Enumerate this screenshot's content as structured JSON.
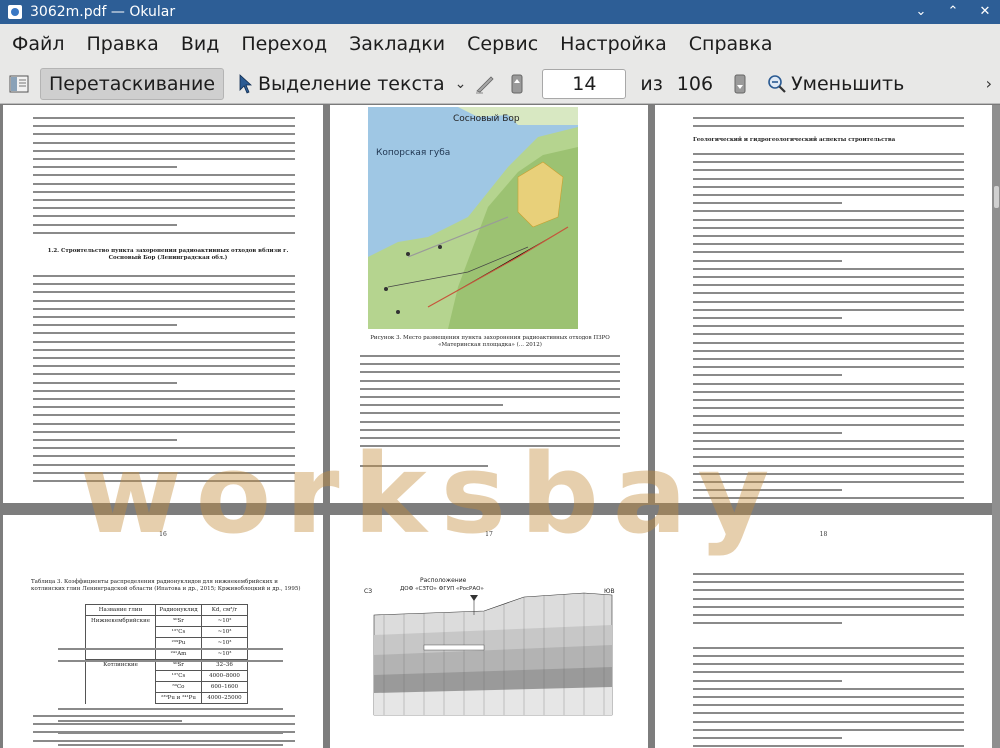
{
  "window": {
    "title": "3062m.pdf  — Okular"
  },
  "menu": {
    "items": [
      "Файл",
      "Правка",
      "Вид",
      "Переход",
      "Закладки",
      "Сервис",
      "Настройка",
      "Справка"
    ]
  },
  "toolbar": {
    "drag_label": "Перетаскивание",
    "select_label": "Выделение текста",
    "page_value": "14",
    "of_label": "из",
    "total_pages": "106",
    "zoom_label": "Уменьшить"
  },
  "pages": {
    "p15_map": {
      "label_top": "Сосновый Бор",
      "label_bay": "Копорская губа",
      "caption": "Рисунок 3. Место размещения пункта захоронения радиоактивных отходов ПЗРО «Материнская площадка» (... 2012)"
    },
    "p16": {
      "num": "16"
    },
    "p17": {
      "num": "17",
      "fig_title": "Расположение",
      "fig_sub": "ДОФ «СЗТО» ФГУП «РосРАО»",
      "left_mark": "СЗ",
      "right_mark": "ЮВ"
    },
    "p18": {
      "num": "18"
    },
    "table": {
      "caption": "Таблица 3. Коэффициенты распределения радионуклидов для нижнекембрийских и котлинских глин Ленинградской области (Ипатова и др., 2015; Крживоблоцкий и др., 1995)",
      "headers": [
        "Название глин",
        "Радионуклид",
        "Kd, см³/г"
      ],
      "rows": [
        [
          "Нижнекембрийские",
          "⁹⁰Sr",
          "~10²"
        ],
        [
          "",
          "¹³⁷Cs",
          "~10³"
        ],
        [
          "",
          "²³⁹Pu",
          "~10³"
        ],
        [
          "",
          "²⁴¹Am",
          "~10³"
        ],
        [
          "Котлинские",
          "⁹⁰Sr",
          "32–36"
        ],
        [
          "",
          "¹³⁷Cs",
          "4000–8000"
        ],
        [
          "",
          "⁶⁰Co",
          "600–1600"
        ],
        [
          "",
          "²³⁹Pu и ²⁴¹Pu",
          "4000–25000"
        ]
      ]
    },
    "p16_heading": "1.2. Строительство пункта захоронения радиоактивных отходов вблизи г. Сосновый Бор (Ленинградская обл.)",
    "p14_right_heading": "Геологический и гидрогеологический аспекты строительства"
  },
  "watermark": "worksbay"
}
